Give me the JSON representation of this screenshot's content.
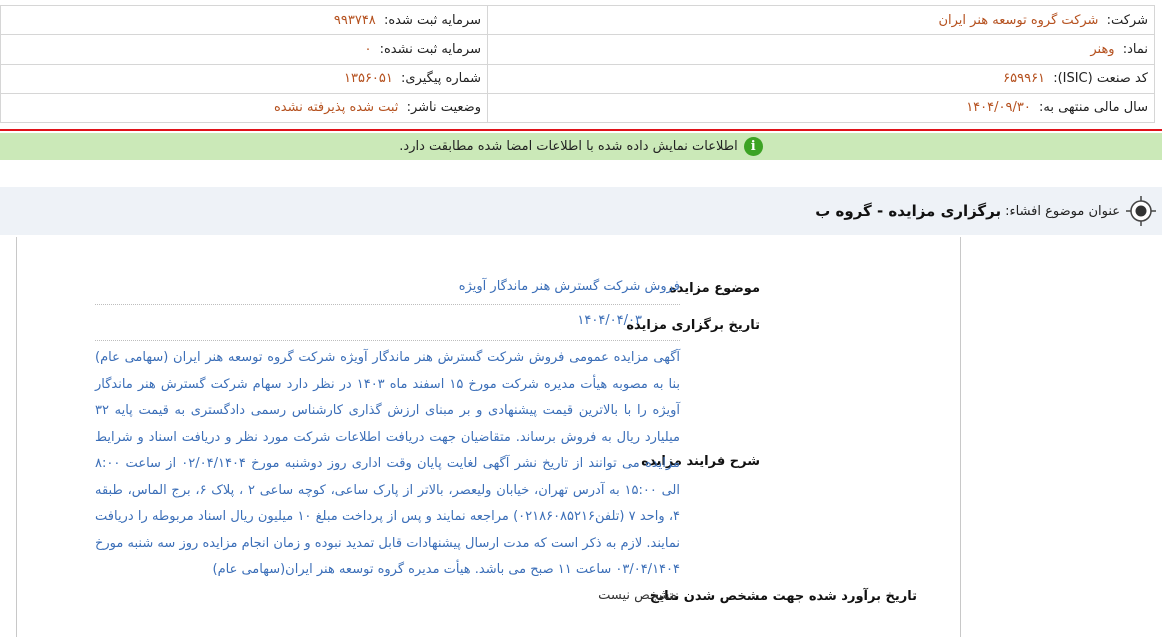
{
  "header": {
    "company_label": "شرکت:",
    "company_value": "شرکت گروه توسعه هنر ایران",
    "symbol_label": "نماد:",
    "symbol_value": "وهنر",
    "isic_label": "کد صنعت (ISIC):",
    "isic_value": "۶۵۹۹۶۱",
    "fiscal_label": "سال مالی منتهی به:",
    "fiscal_value": "۱۴۰۴/۰۹/۳۰",
    "registered_capital_label": "سرمایه ثبت شده:",
    "registered_capital_value": "۹۹۳۷۴۸",
    "unregistered_capital_label": "سرمایه ثبت نشده:",
    "unregistered_capital_value": "۰",
    "tracking_label": "شماره پیگیری:",
    "tracking_value": "۱۳۵۶۰۵۱",
    "publisher_status_label": "وضعیت ناشر:",
    "publisher_status_value": "ثبت شده پذیرفته نشده"
  },
  "notice": {
    "icon": "info-icon",
    "text": "اطلاعات نمایش داده شده با اطلاعات امضا شده مطابقت دارد."
  },
  "topic": {
    "icon": "target-icon",
    "label": "عنوان موضوع افشاء:",
    "value": "برگزاری مزایده - گروه ب"
  },
  "details": {
    "subject_label": "موضوع مزایده",
    "subject_value": "فروش شرکت گسترش هنر ماندگار آویژه",
    "date_label": "تاریخ برگزاری مزایده",
    "date_value": "۱۴۰۴/۰۴/۰۳",
    "process_label": "شرح فرایند مزایده",
    "process_value": "آگهی مزایده عمومی فروش شرکت گسترش هنر ماندگار آویژه شرکت گروه توسعه هنر ایران (سهامی عام) بنا به مصوبه هیأت مدیره شرکت مورخ ۱۵ اسفند ماه ۱۴۰۳ در نظر دارد سهام شرکت گسترش هنر ماندگار آویژه را با بالاترین قیمت پیشنهادی و بر مبنای ارزش گذاری کارشناس رسمی دادگستری به قیمت پایه ۳۲ میلیارد ریال به فروش برساند. متقاضیان جهت دریافت اطلاعات شرکت مورد نظر و دریافت اسناد و شرایط مزایده می توانند از تاریخ نشر آگهی لغایت پایان وقت اداری روز دوشنبه مورخ ۰۲/۰۴/۱۴۰۴ از ساعت ۸:۰۰ الی ۱۵:۰۰ به آدرس تهران، خیابان ولیعصر، بالاتر از پارک ساعی، کوچه ساعی ۲ ، پلاک ۶، برج الماس، طبقه ۴، واحد ۷ (تلفن۰۲۱۸۶۰۸۵۲۱۶) مراجعه نمایند و پس از پرداخت مبلغ ۱۰ میلیون ریال اسناد مربوطه را دریافت نمایند. لازم به ذکر است که مدت ارسال پیشنهادات قابل تمدید نبوده و زمان انجام مزایده روز سه شنبه مورخ ۰۳/۰۴/۱۴۰۴ ساعت ۱۱ صبح می باشد. هیأت مدیره گروه توسعه هنر ایران(سهامی عام)",
    "estimate_label": "تاریخ برآورد شده جهت مشخص شدن نتایج",
    "estimate_value": "مشخص نیست"
  },
  "colors": {
    "accent_value": "#b5511f",
    "link_blue": "#3c6fb8",
    "notice_bg": "#cbe9b8",
    "separator_red": "#e0121a",
    "topic_bg": "#eef2f7"
  }
}
